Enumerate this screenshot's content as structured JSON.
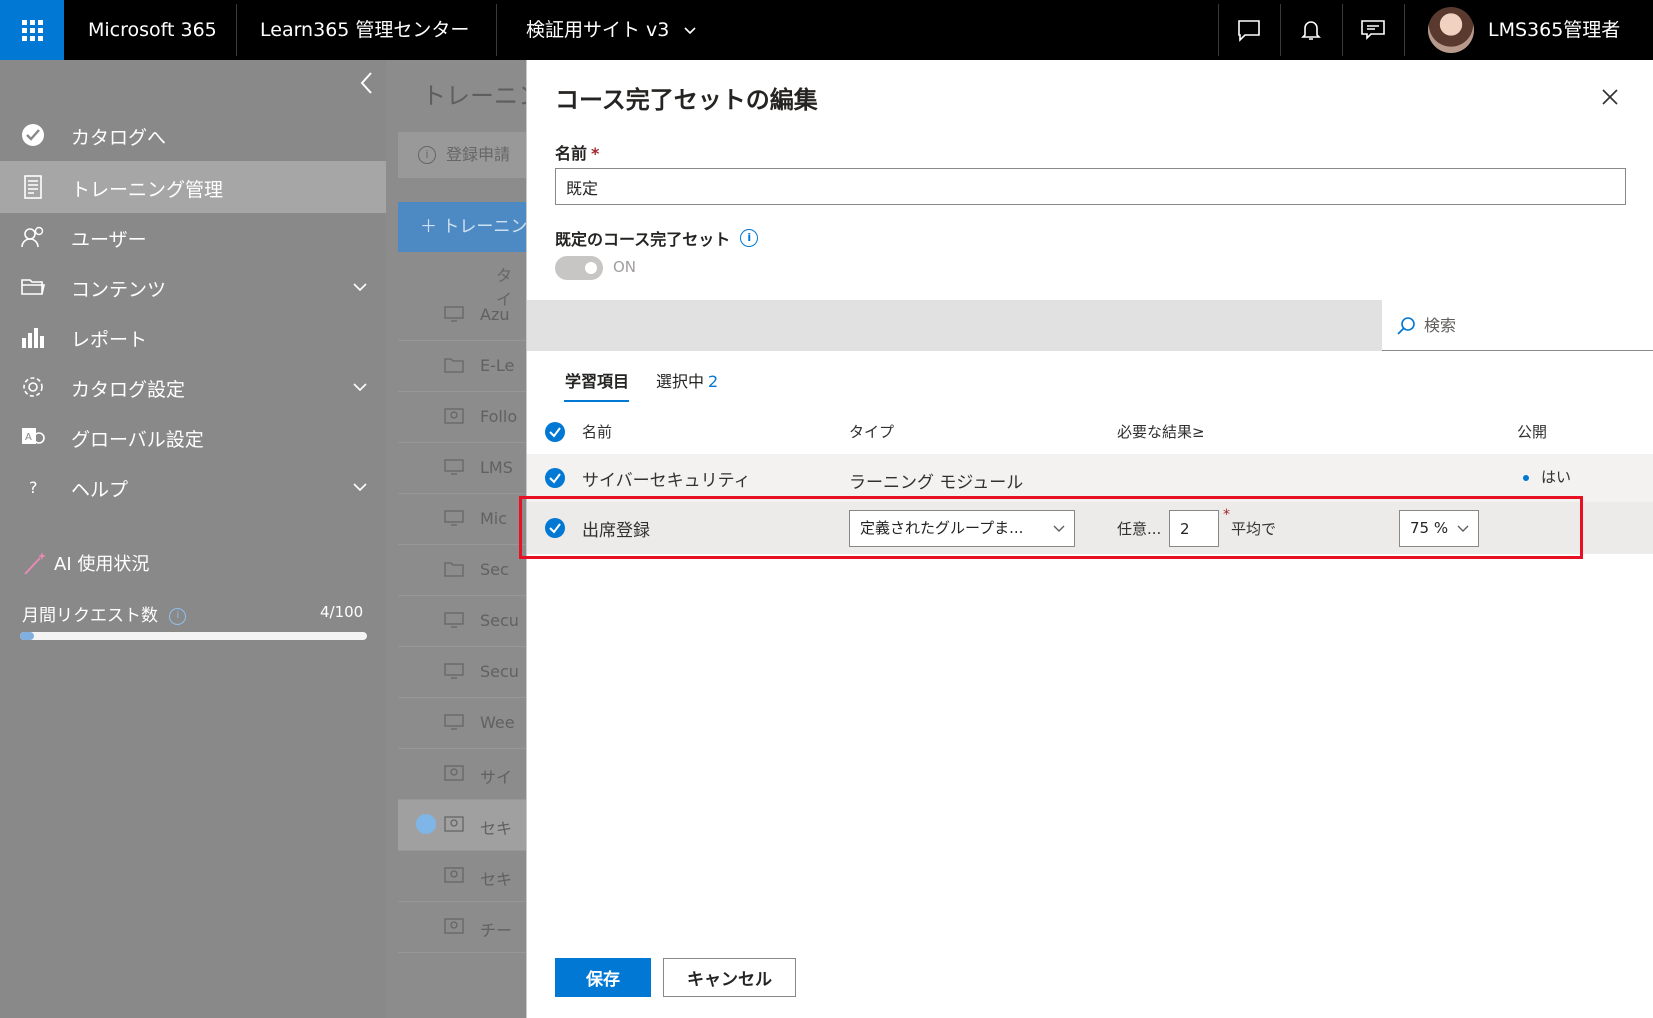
{
  "topbar": {
    "brand": "Microsoft 365",
    "admin_center": "Learn365 管理センター",
    "site": "検証用サイト v3",
    "user_name": "LMS365管理者"
  },
  "sidebar": {
    "items": [
      {
        "label": "カタログへ",
        "icon": "catalog-icon"
      },
      {
        "label": "トレーニング管理",
        "icon": "training-icon"
      },
      {
        "label": "ユーザー",
        "icon": "users-icon"
      },
      {
        "label": "コンテンツ",
        "icon": "folder-icon"
      },
      {
        "label": "レポート",
        "icon": "chart-icon"
      },
      {
        "label": "カタログ設定",
        "icon": "gear-icon"
      },
      {
        "label": "グローバル設定",
        "icon": "global-settings-icon"
      },
      {
        "label": "ヘルプ",
        "icon": "help-icon"
      }
    ],
    "ai_usage": "AI 使用状況",
    "monthly_requests_label": "月間リクエスト数",
    "monthly_requests_value": "4/100",
    "monthly_requests_fraction": 0.04
  },
  "background": {
    "title": "トレーニン",
    "notice": "登録申請",
    "add_button": "＋ トレーニン",
    "column": "タイ",
    "rows": [
      "Azu",
      "E-Le",
      "Follo",
      "LMS",
      "Mic",
      "Sec",
      "Secu",
      "Secu",
      "Wee",
      "サイ",
      "セキ",
      "セキ",
      "チー"
    ]
  },
  "panel": {
    "title": "コース完了セットの編集",
    "name_label": "名前",
    "required_mark": "*",
    "name_value": "既定",
    "default_label": "既定のコース完了セット",
    "toggle_text": "ON",
    "search_placeholder": "検索",
    "tabs": {
      "learning_items": "学習項目",
      "selected": "選択中",
      "selected_count": "2"
    },
    "columns": {
      "name": "名前",
      "type": "タイプ",
      "required_result": "必要な結果≥",
      "published": "公開"
    },
    "rows": [
      {
        "name": "サイバーセキュリティ",
        "type": "ラーニング モジュール",
        "published": "はい"
      },
      {
        "name": "出席登録",
        "type_select": "定義されたグループま...",
        "any_label": "任意...",
        "count": "2",
        "average_label": "平均で",
        "percent": "75 %"
      }
    ],
    "save": "保存",
    "cancel": "キャンセル"
  }
}
